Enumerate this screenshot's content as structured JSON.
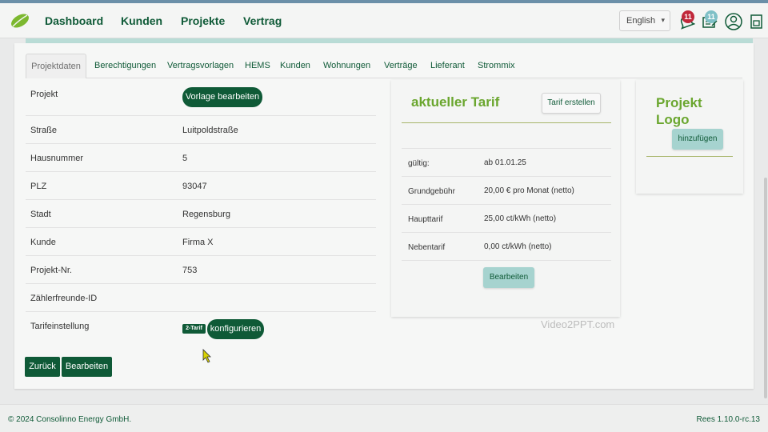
{
  "nav": {
    "links": [
      "Dashboard",
      "Kunden",
      "Projekte",
      "Vertrag"
    ],
    "language": "English",
    "notification_count": "11",
    "task_count": "11"
  },
  "tabs": [
    "Projektdaten",
    "Berechtigungen",
    "Vertragsvorlagen",
    "HEMS",
    "Kunden",
    "Wohnungen",
    "Verträge",
    "Lieferant",
    "Strommix"
  ],
  "project": {
    "fields": [
      {
        "label": "Projekt",
        "value": ""
      },
      {
        "label": "Straße",
        "value": "Luitpoldstraße"
      },
      {
        "label": "Hausnummer",
        "value": "5"
      },
      {
        "label": "PLZ",
        "value": "93047"
      },
      {
        "label": "Stadt",
        "value": "Regensburg"
      },
      {
        "label": "Kunde",
        "value": "Firma X"
      },
      {
        "label": "Projekt-Nr.",
        "value": "753"
      },
      {
        "label": "Zählerfreunde-ID",
        "value": ""
      },
      {
        "label": "Tarifeinstellung",
        "value": ""
      }
    ],
    "template_button": "Vorlage bearbeiten",
    "tariff_tag": "2-Tarif",
    "configure_button": "konfigurieren",
    "back_button": "Zurück",
    "edit_button": "Bearbeiten"
  },
  "tariff": {
    "title": "aktueller Tarif",
    "create_button": "Tarif erstellen",
    "rows": [
      {
        "label": "gültig:",
        "value": "ab 01.01.25"
      },
      {
        "label": "Grundgebühr",
        "value": "20,00 € pro Monat (netto)"
      },
      {
        "label": "Haupttarif",
        "value": "25,00 ct/kWh (netto)"
      },
      {
        "label": "Nebentarif",
        "value": "0,00 ct/kWh (netto)"
      }
    ],
    "edit_button": "Bearbeiten"
  },
  "logo_card": {
    "title": "Projekt Logo",
    "add_button": "hinzufügen"
  },
  "watermark": "Video2PPT.com",
  "footer": {
    "copyright": "© 2024 Consolinno Energy GmbH.",
    "version": "Rees 1.10.0-rc.13"
  },
  "colors": {
    "primary": "#0f5a37",
    "accent_green": "#6aa62e",
    "teal": "#a6d3cf",
    "badge_red": "#c0283a",
    "badge_teal": "#7fc0c7"
  }
}
